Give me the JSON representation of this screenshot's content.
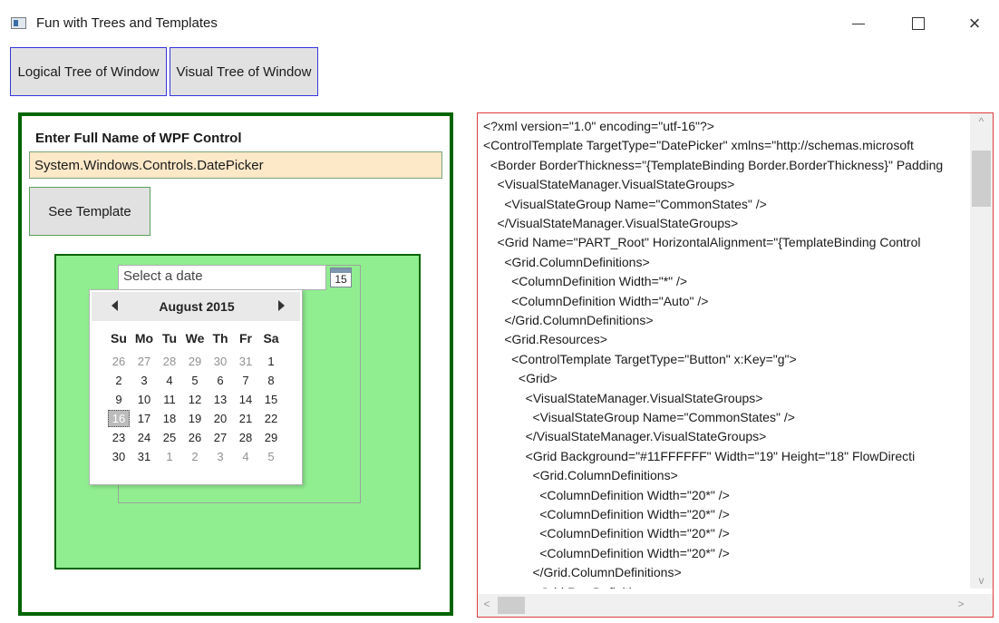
{
  "window": {
    "title": "Fun with Trees and Templates",
    "minimize_glyph": "minimize-icon",
    "maximize_glyph": "maximize-icon",
    "close_glyph": "×"
  },
  "toolbar": {
    "logical_tree_label": "Logical Tree of Window",
    "visual_tree_label": "Visual Tree of Window"
  },
  "left_panel": {
    "label": "Enter Full Name of WPF Control",
    "name_value": "System.Windows.Controls.DatePicker",
    "see_template_label": "See Template",
    "datepicker": {
      "placeholder": "Select a date",
      "calendar_button": "15"
    },
    "calendar": {
      "month_label": "August 2015",
      "prev_icon": "chevron-left-icon",
      "next_icon": "chevron-right-icon",
      "day_headers": [
        "Su",
        "Mo",
        "Tu",
        "We",
        "Th",
        "Fr",
        "Sa"
      ],
      "weeks": [
        [
          "26",
          "27",
          "28",
          "29",
          "30",
          "31",
          "1"
        ],
        [
          "2",
          "3",
          "4",
          "5",
          "6",
          "7",
          "8"
        ],
        [
          "9",
          "10",
          "11",
          "12",
          "13",
          "14",
          "15"
        ],
        [
          "16",
          "17",
          "18",
          "19",
          "20",
          "21",
          "22"
        ],
        [
          "23",
          "24",
          "25",
          "26",
          "27",
          "28",
          "29"
        ],
        [
          "30",
          "31",
          "1",
          "2",
          "3",
          "4",
          "5"
        ]
      ],
      "today": "16"
    }
  },
  "xml_view": {
    "lines": [
      "<?xml version=\"1.0\" encoding=\"utf-16\"?>",
      "<ControlTemplate TargetType=\"DatePicker\" xmlns=\"http://schemas.microsoft",
      "  <Border BorderThickness=\"{TemplateBinding Border.BorderThickness}\" Padding",
      "    <VisualStateManager.VisualStateGroups>",
      "      <VisualStateGroup Name=\"CommonStates\" />",
      "    </VisualStateManager.VisualStateGroups>",
      "    <Grid Name=\"PART_Root\" HorizontalAlignment=\"{TemplateBinding Control",
      "      <Grid.ColumnDefinitions>",
      "        <ColumnDefinition Width=\"*\" />",
      "        <ColumnDefinition Width=\"Auto\" />",
      "      </Grid.ColumnDefinitions>",
      "      <Grid.Resources>",
      "        <ControlTemplate TargetType=\"Button\" x:Key=\"g\">",
      "          <Grid>",
      "            <VisualStateManager.VisualStateGroups>",
      "              <VisualStateGroup Name=\"CommonStates\" />",
      "            </VisualStateManager.VisualStateGroups>",
      "            <Grid Background=\"#11FFFFFF\" Width=\"19\" Height=\"18\" FlowDirecti",
      "              <Grid.ColumnDefinitions>",
      "                <ColumnDefinition Width=\"20*\" />",
      "                <ColumnDefinition Width=\"20*\" />",
      "                <ColumnDefinition Width=\"20*\" />",
      "                <ColumnDefinition Width=\"20*\" />",
      "              </Grid.ColumnDefinitions>",
      "              <Grid.RowDefinitions>"
    ]
  }
}
